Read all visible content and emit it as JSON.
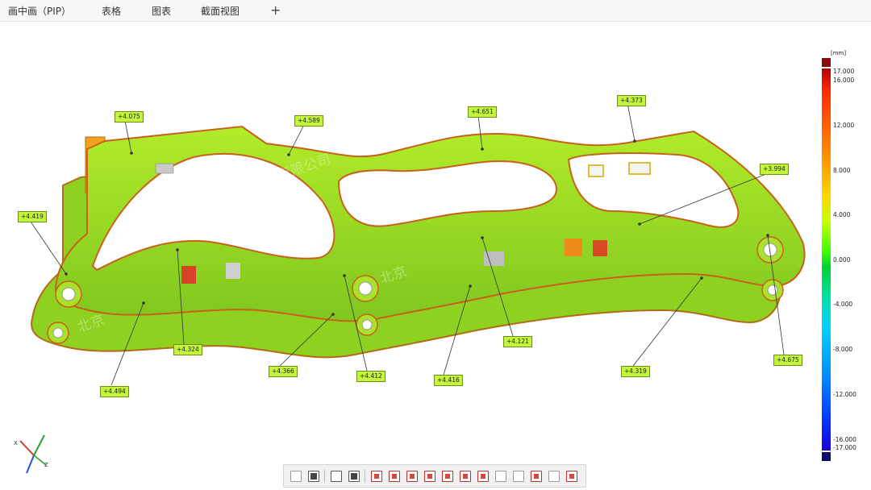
{
  "tabs": [
    {
      "label": "画中画（PIP）"
    },
    {
      "label": "表格"
    },
    {
      "label": "图表"
    },
    {
      "label": "截面视图"
    }
  ],
  "add_tab_symbol": "+",
  "watermark": {
    "line1": "精测电测量技术（北京）有限公司",
    "line2": "北京",
    "line3": "北京"
  },
  "callouts": [
    {
      "id": "c1",
      "text": "+4.075"
    },
    {
      "id": "c2",
      "text": "+4.589"
    },
    {
      "id": "c3",
      "text": "+4.651"
    },
    {
      "id": "c4",
      "text": "+4.373"
    },
    {
      "id": "c5",
      "text": "+3.994"
    },
    {
      "id": "c6",
      "text": "+4.419"
    },
    {
      "id": "c7",
      "text": "+4.324"
    },
    {
      "id": "c8",
      "text": "+4.494"
    },
    {
      "id": "c9",
      "text": "+4.366"
    },
    {
      "id": "c10",
      "text": "+4.412"
    },
    {
      "id": "c11",
      "text": "+4.416"
    },
    {
      "id": "c12",
      "text": "+4.121"
    },
    {
      "id": "c13",
      "text": "+4.319"
    },
    {
      "id": "c14",
      "text": "+4.675"
    }
  ],
  "color_scale": {
    "unit": "[mm]",
    "ticks": [
      "17.000",
      "16.000",
      "12.000",
      "8.000",
      "4.000",
      "0.000",
      "-4.000",
      "-8.000",
      "-12.000",
      "-16.000",
      "-17.000"
    ],
    "top_color": "#8b0a0a",
    "bottom_color": "#0c0c6e"
  },
  "model_color": "#9fe82a",
  "axis_triad": {
    "x_label": "X",
    "z_label": "Z"
  },
  "toolbar_icons": [
    "view-fit-icon",
    "screenshot-icon",
    "select-region-icon",
    "align-icon",
    "point-label-icon",
    "deviation-label-icon",
    "section-icon",
    "frame-icon",
    "measure-icon",
    "angle-icon",
    "link-icon",
    "grid-icon",
    "bounds-icon",
    "report-icon",
    "check-icon",
    "export-icon"
  ]
}
